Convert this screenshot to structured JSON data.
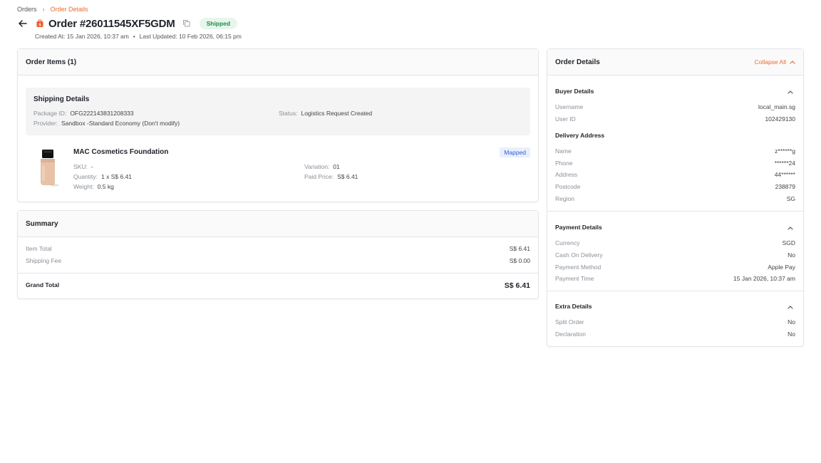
{
  "breadcrumb": {
    "root": "Orders",
    "current": "Order Details"
  },
  "header": {
    "title": "Order #26011545XF5GDM",
    "status": "Shipped",
    "created": "Created At: 15 Jan 2026, 10:37 am",
    "updated": "Last Updated: 10 Feb 2026, 06:15 pm"
  },
  "items": {
    "title": "Order Items (1)",
    "shipping": {
      "title": "Shipping Details",
      "package_label": "Package ID:",
      "package_value": "OFG222143831208333",
      "status_label": "Status:",
      "status_value": "Logistics Request Created",
      "provider_label": "Provider:",
      "provider_value": "Sandbox -Standard Economy (Don't modify)"
    },
    "product": {
      "name": "MAC Cosmetics Foundation",
      "badge": "Mapped",
      "sku_label": "SKU:",
      "sku_value": "-",
      "qty_label": "Quantity:",
      "qty_value": "1 x S$ 6.41",
      "weight_label": "Weight:",
      "weight_value": "0.5 kg",
      "variation_label": "Variation:",
      "variation_value": "01",
      "paid_label": "Paid Price:",
      "paid_value": "S$ 6.41"
    }
  },
  "summary": {
    "title": "Summary",
    "item_total_label": "Item Total",
    "item_total_value": "S$ 6.41",
    "shipping_fee_label": "Shipping Fee",
    "shipping_fee_value": "S$ 0.00",
    "grand_total_label": "Grand Total",
    "grand_total_value": "S$ 6.41"
  },
  "details": {
    "title": "Order Details",
    "collapse_all": "Collapse All",
    "buyer": {
      "title": "Buyer Details",
      "username_label": "Username",
      "username_value": "local_main.sg",
      "userid_label": "User ID",
      "userid_value": "102429130"
    },
    "delivery": {
      "title": "Delivery Address",
      "name_label": "Name",
      "name_value": "z******g",
      "phone_label": "Phone",
      "phone_value": "******24",
      "address_label": "Address",
      "address_value": "44******",
      "postcode_label": "Postcode",
      "postcode_value": "238879",
      "region_label": "Region",
      "region_value": "SG"
    },
    "payment": {
      "title": "Payment Details",
      "currency_label": "Currency",
      "currency_value": "SGD",
      "cod_label": "Cash On Delivery",
      "cod_value": "No",
      "method_label": "Payment Method",
      "method_value": "Apple Pay",
      "time_label": "Payment Time",
      "time_value": "15 Jan 2026, 10:37 am"
    },
    "extra": {
      "title": "Extra Details",
      "split_label": "Split Order",
      "split_value": "No",
      "decl_label": "Declaration",
      "decl_value": "No"
    }
  },
  "colors": {
    "accent": "#ee6a2c",
    "success_bg": "#e7f6ec",
    "success_text": "#1f8b4c",
    "mapped_bg": "#e8f0fe",
    "mapped_text": "#2f5fd0"
  }
}
